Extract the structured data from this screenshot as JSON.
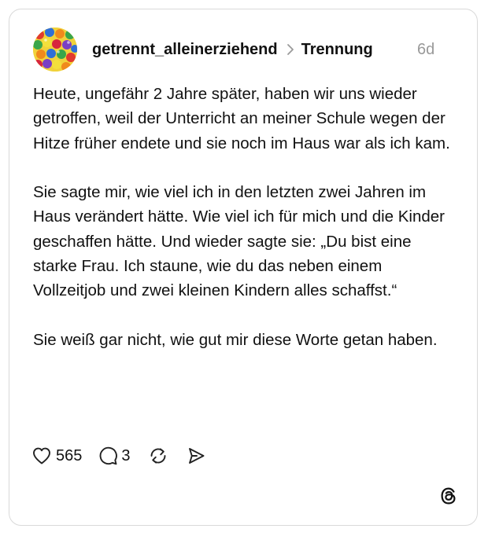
{
  "post": {
    "username": "getrennt_alleinerziehend",
    "topic": "Trennung",
    "age": "6d",
    "paragraphs": [
      "Heute, ungefähr 2 Jahre später, haben wir uns wieder getroffen, weil der Unterricht an meiner Schule wegen der Hitze früher endete und sie noch im Haus war als ich kam.",
      "Sie sagte mir, wie viel ich in den letzten zwei Jahren im Haus verändert hätte. Wie viel ich für mich und die Kinder geschaffen hätte. Und wieder sagte sie: „Du bist eine starke Frau. Ich staune, wie du das neben einem Vollzeitjob und zwei kleinen Kindern alles schaffst.“",
      "Sie weiß gar nicht, wie gut mir diese Worte getan haben."
    ]
  },
  "actions": {
    "likes": "565",
    "replies": "3"
  },
  "icons": {
    "like": "heart-icon",
    "reply": "speech-bubble-icon",
    "repost": "repost-icon",
    "share": "send-icon",
    "logo": "threads-logo-icon"
  }
}
